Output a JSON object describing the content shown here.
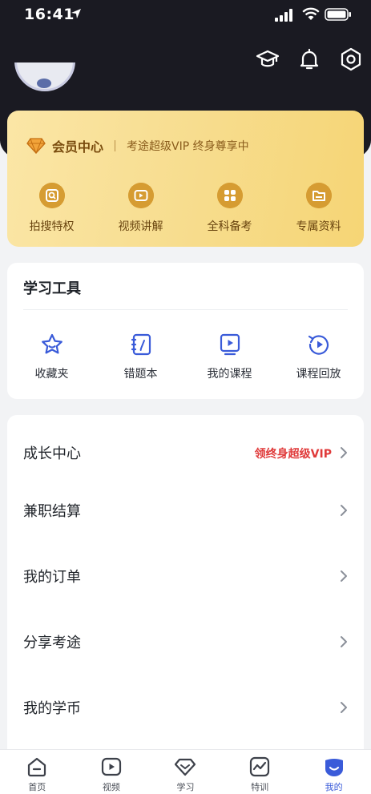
{
  "status_bar": {
    "time": "16:41"
  },
  "vip_card": {
    "title": "会员中心",
    "subtitle": "考途超级VIP 终身尊享中",
    "items": [
      {
        "label": "拍搜特权",
        "icon": "camera-search-icon"
      },
      {
        "label": "视频讲解",
        "icon": "video-play-icon"
      },
      {
        "label": "全科备考",
        "icon": "grid-icon"
      },
      {
        "label": "专属资料",
        "icon": "folder-icon"
      }
    ],
    "accent": "#d69c32"
  },
  "tools": {
    "title": "学习工具",
    "items": [
      {
        "label": "收藏夹",
        "icon": "star-icon"
      },
      {
        "label": "错题本",
        "icon": "notebook-icon"
      },
      {
        "label": "我的课程",
        "icon": "course-icon"
      },
      {
        "label": "课程回放",
        "icon": "replay-icon"
      }
    ],
    "accent": "#3a5bd9"
  },
  "menu": [
    {
      "label": "成长中心",
      "tag": "领终身超级VIP"
    },
    {
      "label": "兼职结算",
      "tag": ""
    },
    {
      "label": "我的订单",
      "tag": ""
    },
    {
      "label": "分享考途",
      "tag": ""
    },
    {
      "label": "我的学币",
      "tag": ""
    }
  ],
  "tabs": [
    {
      "label": "首页",
      "icon": "home-icon",
      "active": false
    },
    {
      "label": "视频",
      "icon": "video-icon",
      "active": false
    },
    {
      "label": "学习",
      "icon": "diamond-icon",
      "active": false
    },
    {
      "label": "特训",
      "icon": "trend-icon",
      "active": false
    },
    {
      "label": "我的",
      "icon": "profile-icon",
      "active": true
    }
  ]
}
